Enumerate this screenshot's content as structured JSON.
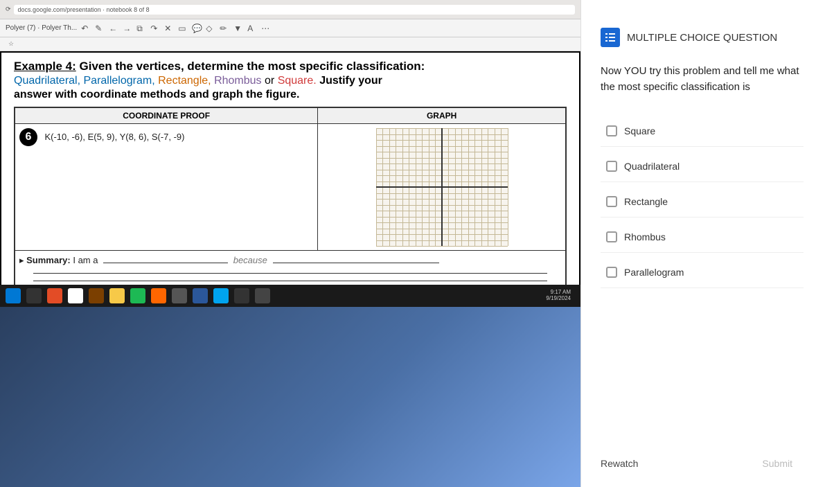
{
  "browser": {
    "url": "docs.google.com/presentation",
    "tab": "notebook 8 of 8"
  },
  "toolbar": {
    "doc_label": "Polyer (7) · Polyer Th..."
  },
  "slide": {
    "example_label": "Example 4:",
    "example_text": "Given the vertices, determine the most specific classification:",
    "shapes": {
      "quad": "Quadrilateral,",
      "para": "Parallelogram,",
      "rect": "Rectangle,",
      "rhom": "Rhombus",
      "or": "or",
      "sqr": "Square."
    },
    "justify": "Justify your",
    "note": "answer with coordinate methods and graph the figure.",
    "col1": "COORDINATE PROOF",
    "col2": "GRAPH",
    "num": "6",
    "coords": "K(-10, -6), E(5, 9), Y(8, 6), S(-7, -9)",
    "summary_label": "Summary:",
    "summary_text": "I am a",
    "because": "because"
  },
  "clock": {
    "time": "9:17 AM",
    "date": "9/19/2024"
  },
  "question": {
    "header": "MULTIPLE CHOICE QUESTION",
    "prompt": "Now YOU try this problem and tell me what the most specific classification is",
    "options": [
      "Square",
      "Quadrilateral",
      "Rectangle",
      "Rhombus",
      "Parallelogram"
    ],
    "rewatch": "Rewatch",
    "submit": "Submit"
  }
}
